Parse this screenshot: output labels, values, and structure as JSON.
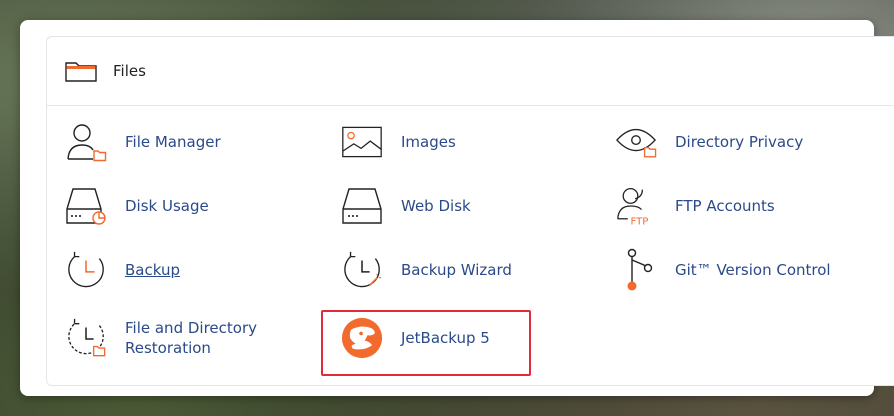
{
  "panel": {
    "title": "Files"
  },
  "items": {
    "file_manager": "File Manager",
    "images": "Images",
    "directory_privacy": "Directory Privacy",
    "disk_usage": "Disk Usage",
    "web_disk": "Web Disk",
    "ftp_accounts": "FTP Accounts",
    "backup": "Backup",
    "backup_wizard": "Backup Wizard",
    "git_version_control": "Git™ Version Control",
    "file_directory_restoration_line1": "File and Directory",
    "file_directory_restoration_line2": "Restoration",
    "jetbackup": "JetBackup 5"
  },
  "icons": {
    "ftp_text": "FTP"
  },
  "colors": {
    "accent_orange": "#f26a2e",
    "link_blue": "#2a4a8a",
    "highlight_red": "#e12b3a"
  }
}
